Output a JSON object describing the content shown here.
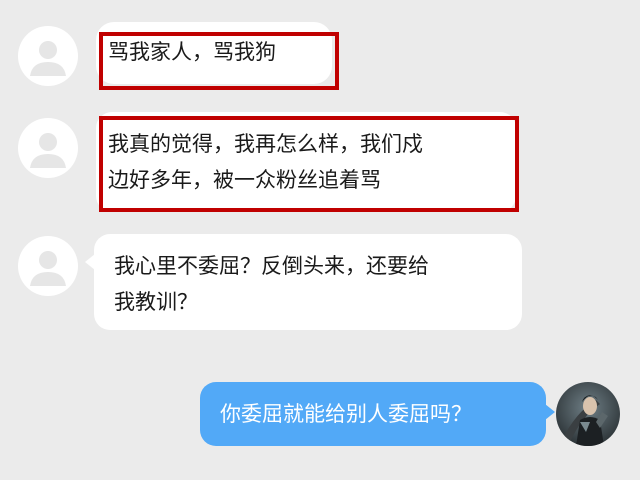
{
  "messages": [
    {
      "direction": "incoming",
      "avatar_icon": "default-user-avatar-icon",
      "lines": [
        "骂我家人，骂我狗"
      ],
      "highlighted": true
    },
    {
      "direction": "incoming",
      "avatar_icon": "default-user-avatar-icon",
      "lines": [
        "我真的觉得，我再怎么样，我们戍",
        "边好多年，被一众粉丝追着骂"
      ],
      "highlighted": true
    },
    {
      "direction": "incoming",
      "avatar_icon": "default-user-avatar-icon",
      "lines": [
        "我心里不委屈？反倒头来，还要给",
        "我教训？"
      ],
      "highlighted": false
    },
    {
      "direction": "outgoing",
      "avatar_icon": "character-photo-avatar-icon",
      "lines": [
        "你委屈就能给别人委屈吗？"
      ],
      "highlighted": false
    }
  ],
  "colors": {
    "background": "#ebebeb",
    "incoming_bubble": "#ffffff",
    "outgoing_bubble": "#52a9f7",
    "highlight_border": "#c00000"
  }
}
